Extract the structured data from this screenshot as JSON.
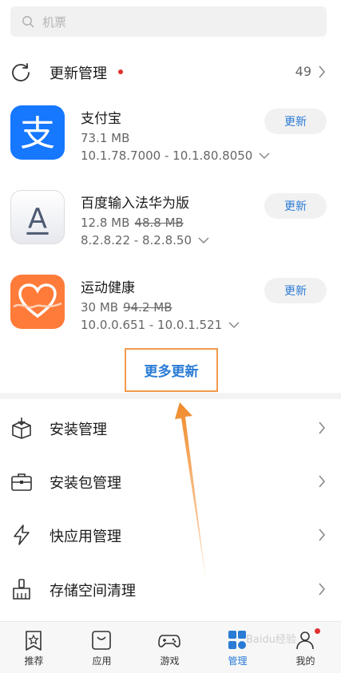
{
  "search": {
    "placeholder": "机票",
    "icon": "search-icon"
  },
  "updates": {
    "title": "更新管理",
    "count": "49",
    "accent": "#2a7bd6",
    "dot_color": "#e0322f"
  },
  "apps": [
    {
      "name": "支付宝",
      "size": "73.1 MB",
      "old_size": "",
      "version": "10.1.78.7000 - 10.1.80.8050",
      "button": "更新",
      "icon": "alipay-icon"
    },
    {
      "name": "百度输入法华为版",
      "size": "12.8 MB",
      "old_size": "48.8 MB",
      "version": "8.2.8.22 - 8.2.8.50",
      "button": "更新",
      "icon": "baidu-ime-icon"
    },
    {
      "name": "运动健康",
      "size": "30 MB",
      "old_size": "94.2 MB",
      "version": "10.0.0.651 - 10.0.1.521",
      "button": "更新",
      "icon": "health-icon"
    }
  ],
  "more_updates": "更多更新",
  "menu": [
    {
      "label": "安装管理",
      "icon": "install-box-icon"
    },
    {
      "label": "安装包管理",
      "icon": "briefcase-icon"
    },
    {
      "label": "快应用管理",
      "icon": "lightning-icon"
    },
    {
      "label": "存储空间清理",
      "icon": "broom-icon"
    }
  ],
  "tabs": [
    {
      "label": "推荐",
      "icon": "star-bookmark-icon",
      "active": false
    },
    {
      "label": "应用",
      "icon": "app-store-icon",
      "active": false
    },
    {
      "label": "游戏",
      "icon": "gamepad-icon",
      "active": false
    },
    {
      "label": "管理",
      "icon": "manage-grid-icon",
      "active": true
    },
    {
      "label": "我的",
      "icon": "user-icon",
      "active": false
    }
  ],
  "watermark": "Baidu经验"
}
